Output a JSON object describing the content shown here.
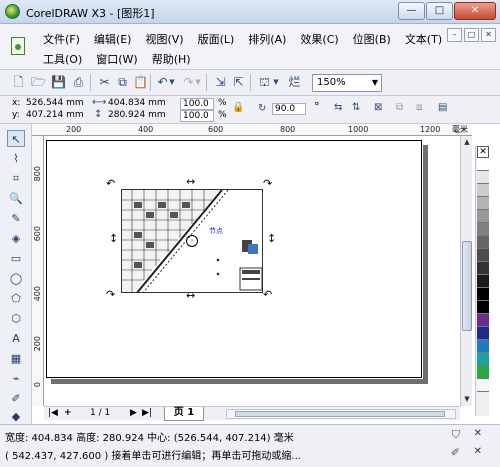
{
  "window": {
    "title": "CorelDRAW X3 - [图形1]",
    "minimize": "—",
    "maximize": "□",
    "close": "✕"
  },
  "menu": {
    "row1": [
      "文件(F)",
      "编辑(E)",
      "视图(V)",
      "版面(L)",
      "排列(A)",
      "效果(C)",
      "位图(B)",
      "文本(T)"
    ],
    "row2": [
      "工具(O)",
      "窗口(W)",
      "帮助(H)"
    ],
    "mdi_buttons": [
      "–",
      "□",
      "✕"
    ]
  },
  "toolbar": {
    "zoom_value": "150%"
  },
  "propbar": {
    "x_label": "x:",
    "x_value": "526.544 mm",
    "y_label": "y:",
    "y_value": "407.214 mm",
    "width_value": "404.834 mm",
    "height_value": "280.924 mm",
    "scale_x": "100.0",
    "scale_y": "100.0",
    "percent": "%",
    "rotation": "90.0",
    "degree": "°"
  },
  "ruler": {
    "top_ticks": [
      "200",
      "400",
      "600",
      "800",
      "1000",
      "1200"
    ],
    "unit": "毫米",
    "left_ticks": [
      "800",
      "600",
      "400",
      "200",
      "0"
    ]
  },
  "canvas": {
    "note_label": "节点"
  },
  "pagebar": {
    "first": "|◀",
    "add_before": "+",
    "page_count": "1 / 1",
    "next": "▶",
    "last": "▶|",
    "tab_label": "页 1"
  },
  "status": {
    "line1": "宽度: 404.834  高度: 280.924  中心: (526.544, 407.214)  毫米",
    "line2": "( 542.437, 427.600 )     接着单击可进行编辑；再单击可拖动或缩..."
  },
  "palette": {
    "colors": [
      "#ffffff",
      "#e6e6e6",
      "#cccccc",
      "#b3b3b3",
      "#999999",
      "#808080",
      "#666666",
      "#4d4d4d",
      "#333333",
      "#1a1a1a",
      "#000000",
      "#000000",
      "#6b2c91",
      "#1c2a8f",
      "#1f7ac2",
      "#1aa4a0",
      "#28a745",
      "#f5f5f5"
    ]
  }
}
